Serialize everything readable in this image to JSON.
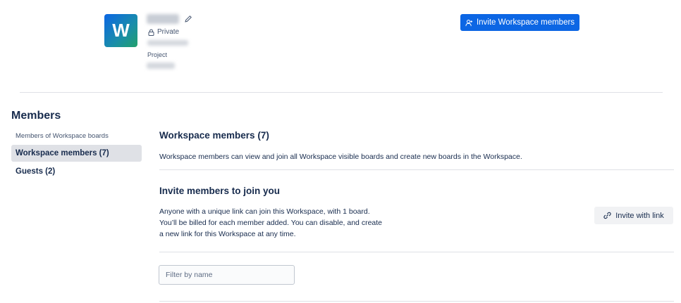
{
  "header": {
    "logo_letter": "W",
    "visibility": "Private",
    "workspace_type": "Project",
    "invite_workspace_button": "Invite Workspace members"
  },
  "sidebar": {
    "title": "Members",
    "subheading": "Members of Workspace boards",
    "items": [
      {
        "label": "Workspace members (7)",
        "active": true
      },
      {
        "label": "Guests (2)",
        "active": false
      }
    ]
  },
  "main": {
    "title": "Workspace members (7)",
    "description": "Workspace members can view and join all Workspace visible boards and create new boards in the Workspace.",
    "invite_section": {
      "title": "Invite members to join you",
      "lines": [
        "Anyone with a unique link can join this Workspace, with 1 board.",
        "You’ll be billed for each member added. You can disable, and create",
        "a new link for this Workspace at any time."
      ],
      "button_label": "Invite with link"
    },
    "filter": {
      "placeholder": "Filter by name",
      "value": ""
    }
  },
  "colors": {
    "primary": "#0c66e4",
    "text": "#172b4d",
    "muted": "#44546f",
    "active_bg": "#dfe1e6"
  }
}
